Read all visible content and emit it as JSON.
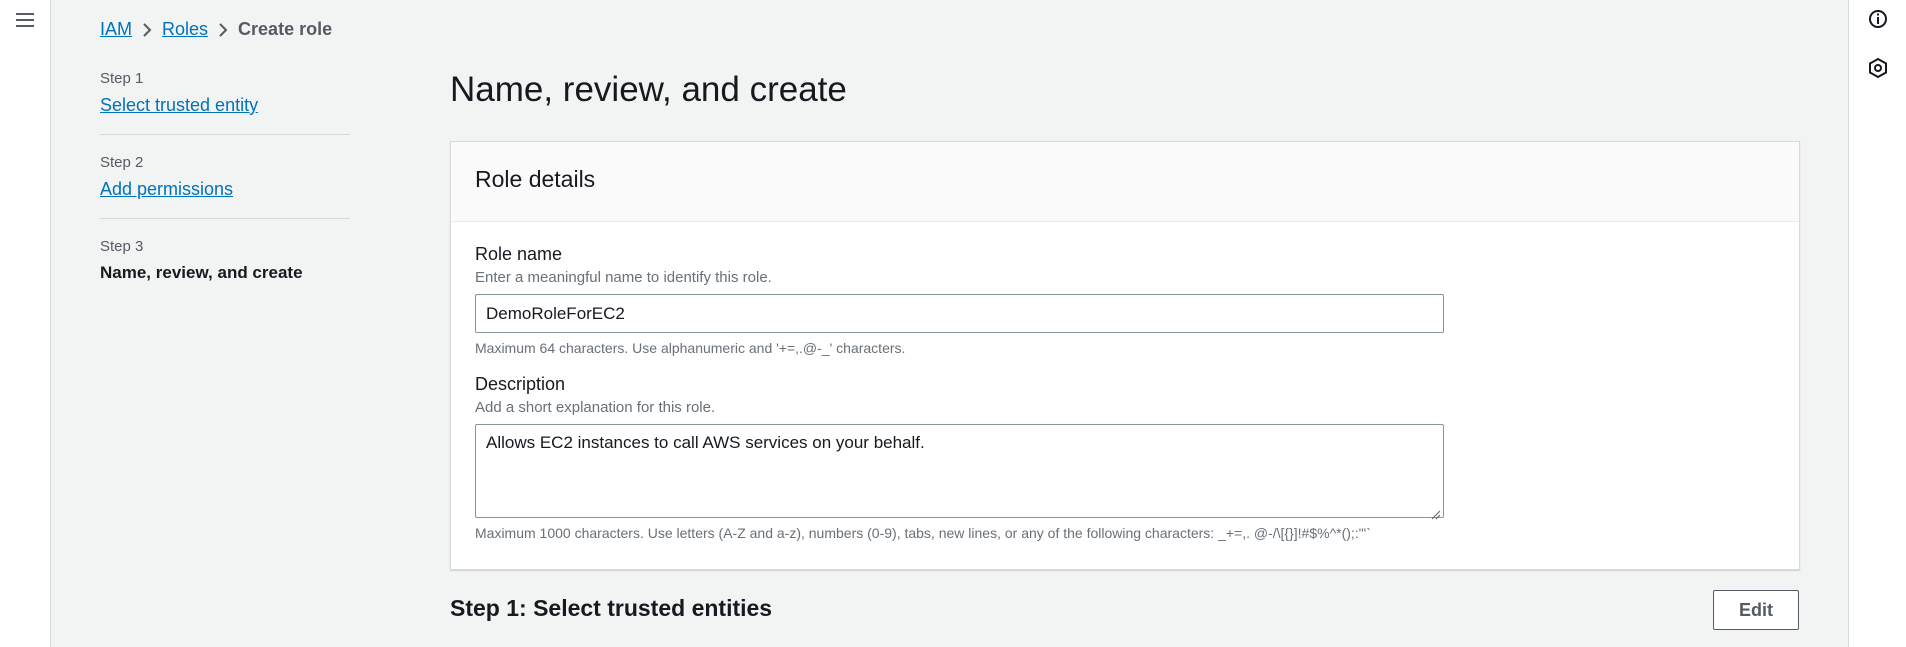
{
  "breadcrumb": {
    "items": [
      "IAM",
      "Roles"
    ],
    "current": "Create role"
  },
  "steps": [
    {
      "number": "Step 1",
      "label": "Select trusted entity"
    },
    {
      "number": "Step 2",
      "label": "Add permissions"
    },
    {
      "number": "Step 3",
      "label": "Name, review, and create"
    }
  ],
  "main": {
    "title": "Name, review, and create",
    "role_details": {
      "header": "Role details",
      "role_name": {
        "label": "Role name",
        "description": "Enter a meaningful name to identify this role.",
        "value": "DemoRoleForEC2",
        "hint": "Maximum 64 characters. Use alphanumeric and '+=,.@-_' characters."
      },
      "description": {
        "label": "Description",
        "description": "Add a short explanation for this role.",
        "value": "Allows EC2 instances to call AWS services on your behalf.",
        "hint": "Maximum 1000 characters. Use letters (A-Z and a-z), numbers (0-9), tabs, new lines, or any of the following characters: _+=,. @-/\\[{}]!#$%^*();:\"'`"
      }
    },
    "step1_section": {
      "title": "Step 1: Select trusted entities",
      "edit_label": "Edit"
    }
  },
  "icons": {
    "menu": "hamburger-icon",
    "info": "info-icon",
    "tool": "hexagon-tool-icon"
  },
  "colors": {
    "link": "#0073bb",
    "background": "#f2f3f3"
  }
}
